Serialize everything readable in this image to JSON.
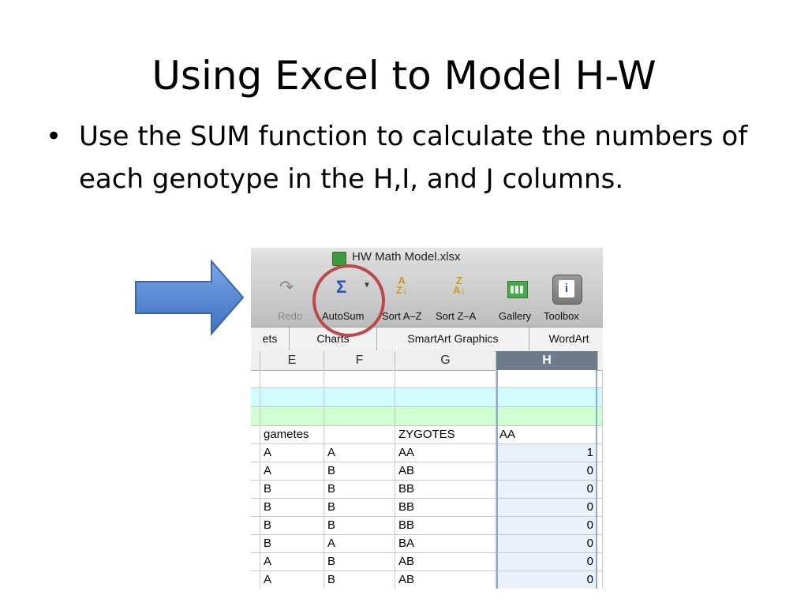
{
  "slide": {
    "title": "Using Excel to Model H-W",
    "bullet": "Use the SUM function to calculate the numbers of each genotype in the H,I, and J columns."
  },
  "window": {
    "title": "HW Math Model.xlsx"
  },
  "toolbar": {
    "redo_label": "Redo",
    "autosum_label": "AutoSum",
    "sort_az_label": "Sort A–Z",
    "sort_za_label": "Sort Z–A",
    "gallery_label": "Gallery",
    "toolbox_label": "Toolbox"
  },
  "ribbon_tabs": [
    "ets",
    "Charts",
    "SmartArt Graphics",
    "WordArt"
  ],
  "column_headers": [
    "E",
    "F",
    "G",
    "H"
  ],
  "rows": [
    {
      "c1": "",
      "c2": "",
      "c3": "",
      "c4": "",
      "band": ""
    },
    {
      "c1": "",
      "c2": "",
      "c3": "",
      "c4": "",
      "band": "cyan"
    },
    {
      "c1": "",
      "c2": "",
      "c3": "",
      "c4": "",
      "band": "green"
    },
    {
      "c1": "gametes",
      "c2": "",
      "c3": "ZYGOTES",
      "c4": "AA",
      "band": ""
    },
    {
      "c1": "A",
      "c2": "A",
      "c3": "AA",
      "c4": "1",
      "band": ""
    },
    {
      "c1": "A",
      "c2": "B",
      "c3": "AB",
      "c4": "0",
      "band": ""
    },
    {
      "c1": "B",
      "c2": "B",
      "c3": "BB",
      "c4": "0",
      "band": ""
    },
    {
      "c1": "B",
      "c2": "B",
      "c3": "BB",
      "c4": "0",
      "band": ""
    },
    {
      "c1": "B",
      "c2": "B",
      "c3": "BB",
      "c4": "0",
      "band": ""
    },
    {
      "c1": "B",
      "c2": "A",
      "c3": "BA",
      "c4": "0",
      "band": ""
    },
    {
      "c1": "A",
      "c2": "B",
      "c3": "AB",
      "c4": "0",
      "band": ""
    },
    {
      "c1": "A",
      "c2": "B",
      "c3": "AB",
      "c4": "0",
      "band": ""
    }
  ],
  "colors": {
    "arrow": "#5b8fd8",
    "highlight_circle": "#b94a48",
    "selected_header": "#6d7b8a"
  },
  "icons": [
    "document-icon",
    "redo-icon",
    "sigma-icon",
    "sort-az-icon",
    "sort-za-icon",
    "gallery-icon",
    "toolbox-icon",
    "arrow-icon"
  ]
}
